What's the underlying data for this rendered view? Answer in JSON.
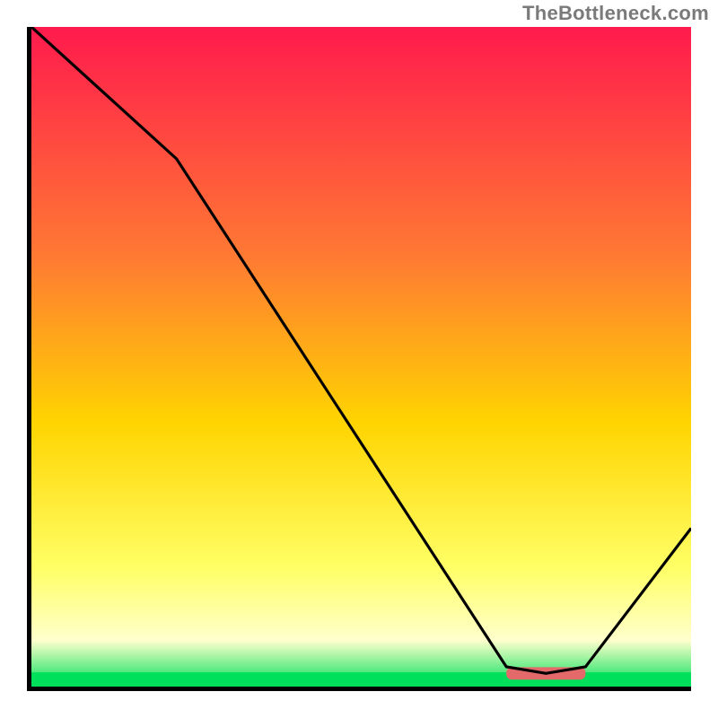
{
  "attribution": "TheBottleneck.com",
  "colors": {
    "gradient_top": "#ff1a4d",
    "gradient_mid_upper": "#ff7a33",
    "gradient_mid": "#ffd400",
    "gradient_lower": "#ffff66",
    "gradient_pale": "#ffffcc",
    "gradient_bottom": "#00e05a",
    "curve": "#000000",
    "marker_fill": "#e46a6a",
    "axis": "#000000"
  },
  "chart_data": {
    "type": "line",
    "title": "",
    "xlabel": "",
    "ylabel": "",
    "xlim": [
      0,
      100
    ],
    "ylim": [
      0,
      100
    ],
    "grid": false,
    "legend": false,
    "x": [
      0,
      22,
      72,
      78,
      84,
      100
    ],
    "values": [
      100,
      80,
      3,
      2,
      3,
      24
    ],
    "marker": {
      "x_start": 72,
      "x_end": 84,
      "y": 2
    },
    "description": "Single black curve starting at top-left, descending through a knee near x≈22, reaching a minimum plateau around x≈72–84 (highlighted by a pink bar), then rising toward the right edge. Background is a vertical red→orange→yellow→pale-yellow→green gradient (green at the bottom)."
  }
}
